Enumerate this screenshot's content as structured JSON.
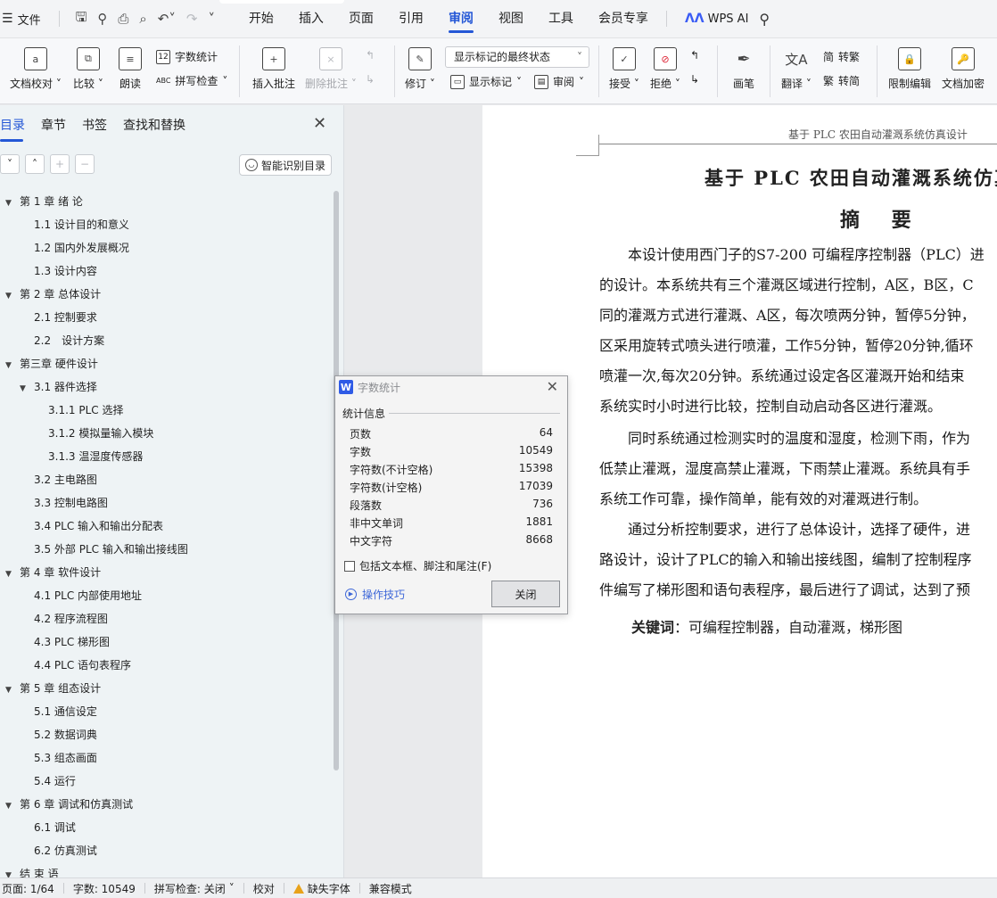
{
  "menubar": {
    "file": "文件",
    "tabs": [
      "开始",
      "插入",
      "页面",
      "引用",
      "审阅",
      "视图",
      "工具",
      "会员专享"
    ],
    "active_tab": "审阅",
    "wps_ai": "WPS AI"
  },
  "ribbon": {
    "doc_check": "文档校对",
    "compare": "比较",
    "read_aloud": "朗读",
    "word_count": "字数统计",
    "spell_check": "拼写检查",
    "insert_comment": "插入批注",
    "delete_comment": "删除批注",
    "track_changes": "修订",
    "markup_select": "显示标记的最终状态",
    "show_markup": "显示标记",
    "review": "审阅",
    "accept": "接受",
    "reject": "拒绝",
    "ink": "画笔",
    "translate": "翻译",
    "to_traditional": "转繁",
    "to_simplified": "转简",
    "restrict_edit": "限制编辑",
    "encrypt": "文档加密"
  },
  "nav": {
    "tabs": [
      "目录",
      "章节",
      "书签",
      "查找和替换"
    ],
    "smart_toc": "智能识别目录",
    "toc": [
      "第 1 章 绪 论",
      "1.1 设计目的和意义",
      "1.2 国内外发展概况",
      "1.3 设计内容",
      "第 2 章 总体设计",
      "2.1 控制要求",
      "2.2　设计方案",
      "第三章 硬件设计",
      "3.1 器件选择",
      "3.1.1 PLC 选择",
      "3.1.2 模拟量输入模块",
      "3.1.3 温湿度传感器",
      "3.2 主电路图",
      "3.3 控制电路图",
      "3.4 PLC 输入和输出分配表",
      "3.5 外部 PLC 输入和输出接线图",
      "第 4 章 软件设计",
      "4.1 PLC 内部使用地址",
      "4.2 程序流程图",
      "4.3 PLC 梯形图",
      "4.4 PLC 语句表程序",
      "第 5 章 组态设计",
      "5.1 通信设定",
      "5.2 数据词典",
      "5.3 组态画面",
      "5.4 运行",
      "第 6 章 调试和仿真测试",
      "6.1 调试",
      "6.2 仿真测试",
      "结 束 语"
    ]
  },
  "document": {
    "header": "基于 PLC 农田自动灌溉系统仿真设计",
    "title": "基于 PLC 农田自动灌溉系统仿真",
    "subtitle": "摘 要",
    "lines": [
      "本设计使用西门子的S7-200 可编程序控制器（PLC）进",
      "的设计。本系统共有三个灌溉区域进行控制，A区，B区，C",
      "同的灌溉方式进行灌溉、A区，每次喷两分钟，暂停5分钟，",
      "区采用旋转式喷头进行喷灌，工作5分钟，暂停20分钟,循环",
      "喷灌一次,每次20分钟。系统通过设定各区灌溉开始和结束",
      "系统实时小时进行比较，控制自动启动各区进行灌溉。",
      "同时系统通过检测实时的温度和湿度，检测下雨，作为",
      "低禁止灌溉，湿度高禁止灌溉，下雨禁止灌溉。系统具有手",
      "系统工作可靠，操作简单，能有效的对灌溉进行制。",
      "通过分析控制要求，进行了总体设计，选择了硬件，进",
      "路设计，设计了PLC的输入和输出接线图，编制了控制程序",
      "件编写了梯形图和语句表程序，最后进行了调试，达到了预"
    ],
    "keywords_label": "关键词",
    "keywords": "：可编程控制器，自动灌溉，梯形图"
  },
  "dialog": {
    "title": "字数统计",
    "section": "统计信息",
    "stats": [
      {
        "label": "页数",
        "value": "64"
      },
      {
        "label": "字数",
        "value": "10549"
      },
      {
        "label": "字符数(不计空格)",
        "value": "15398"
      },
      {
        "label": "字符数(计空格)",
        "value": "17039"
      },
      {
        "label": "段落数",
        "value": "736"
      },
      {
        "label": "非中文单词",
        "value": "1881"
      },
      {
        "label": "中文字符",
        "value": "8668"
      }
    ],
    "include_label": "包括文本框、脚注和尾注(F)",
    "tips": "操作技巧",
    "close": "关闭"
  },
  "statusbar": {
    "page": "页面: 1/64",
    "words": "字数: 10549",
    "spell": "拼写检查: 关闭",
    "proof": "校对",
    "missing_font": "缺失字体",
    "compat": "兼容模式"
  }
}
